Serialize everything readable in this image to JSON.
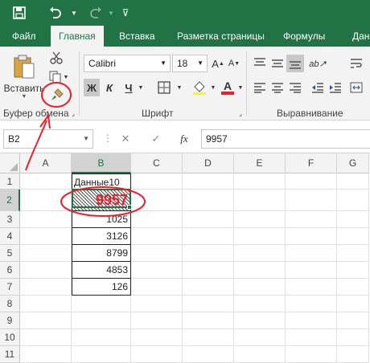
{
  "qat": {
    "icons": [
      "save-icon",
      "undo-icon",
      "redo-icon",
      "customize-icon"
    ]
  },
  "tabs": [
    {
      "label": "Файл",
      "active": false
    },
    {
      "label": "Главная",
      "active": true
    },
    {
      "label": "Вставка",
      "active": false
    },
    {
      "label": "Разметка страницы",
      "active": false
    },
    {
      "label": "Формулы",
      "active": false
    },
    {
      "label": "Дан",
      "active": false
    }
  ],
  "clipboard": {
    "paste_label": "Вставить",
    "group_label": "Буфер обмена"
  },
  "font": {
    "name": "Calibri",
    "size": "18",
    "bold": "Ж",
    "italic": "К",
    "underline": "Ч",
    "group_label": "Шрифт"
  },
  "alignment": {
    "group_label": "Выравнивание"
  },
  "formula_bar": {
    "name_box": "B2",
    "fx": "fx",
    "value": "9957"
  },
  "columns": [
    "A",
    "B",
    "C",
    "D",
    "E",
    "F",
    "G"
  ],
  "rows": [
    "1",
    "2",
    "3",
    "4",
    "5",
    "6",
    "7",
    "8",
    "9",
    "10",
    "11"
  ],
  "cells": {
    "B1": "Данные10",
    "B2": "9957",
    "B3": "1025",
    "B4": "3126",
    "B5": "8799",
    "B6": "4853",
    "B7": "126"
  },
  "selected_cell": "B2",
  "colors": {
    "excel_green": "#217346",
    "annotation_red": "#e8202a",
    "font_color_red": "#e8202a"
  }
}
